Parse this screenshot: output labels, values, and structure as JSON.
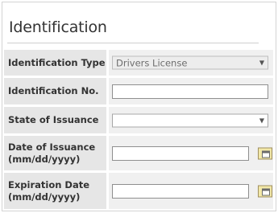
{
  "section": {
    "title": "Identification"
  },
  "fields": [
    {
      "label": "Identification Type",
      "control": "select",
      "value": "Drivers License",
      "disabled": true
    },
    {
      "label": "Identification No.",
      "control": "text",
      "value": ""
    },
    {
      "label": "State of Issuance",
      "control": "select",
      "value": ""
    },
    {
      "label": "Date of Issuance\n(mm/dd/yyyy)",
      "control": "date",
      "value": ""
    },
    {
      "label": "Expiration Date\n(mm/dd/yyyy)",
      "control": "date",
      "value": ""
    }
  ],
  "icons": {
    "dropdown": "chevron-down-icon",
    "calendar": "calendar-icon"
  }
}
